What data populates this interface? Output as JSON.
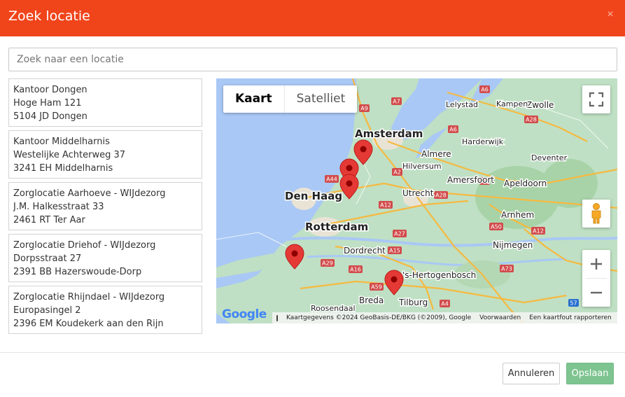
{
  "dialog": {
    "title": "Zoek locatie",
    "close_glyph": "×"
  },
  "search": {
    "placeholder": "Zoek naar een locatie",
    "value": ""
  },
  "locations": [
    {
      "name": "Kantoor Dongen",
      "street": "Hoge Ham  121",
      "city": "5104 JD   Dongen"
    },
    {
      "name": "Kantoor Middelharnis",
      "street": "Westelijke Achterweg  37",
      "city": "3241 EH   Middelharnis"
    },
    {
      "name": "Zorglocatie Aarhoeve - WIJdezorg",
      "street": "J.M. Halkesstraat  33",
      "city": "2461 RT   Ter Aar"
    },
    {
      "name": "Zorglocatie Driehof - WIJdezorg",
      "street": "Dorpsstraat  27",
      "city": "2391 BB   Hazerswoude-Dorp"
    },
    {
      "name": "Zorglocatie Rhijndael - WIJdezorg",
      "street": "Europasingel  2",
      "city": "2396 EM   Koudekerk aan den Rijn"
    }
  ],
  "map": {
    "type_map": "Kaart",
    "type_satellite": "Satelliet",
    "active_type": "Kaart",
    "logo": "Google",
    "attribution": "Kaartgegevens ©2024 GeoBasis-DE/BKG (©2009), Google",
    "terms": "Voorwaarden",
    "report": "Een kaartfout rapporteren",
    "icons": {
      "fullscreen": "fullscreen-icon",
      "pegman": "pegman-icon",
      "zoom_in": "zoom-in-icon",
      "zoom_out": "zoom-out-icon",
      "marker": "map-marker-icon",
      "keyboard": "keyboard-icon"
    },
    "cities": {
      "amsterdam": "Amsterdam",
      "den_haag": "Den Haag",
      "rotterdam": "Rotterdam",
      "utrecht": "Utrecht",
      "almere": "Almere",
      "hilversum": "Hilversum",
      "amersfoort": "Amersfoort",
      "apeldoorn": "Apeldoorn",
      "arnhem": "Arnhem",
      "nijmegen": "Nijmegen",
      "dordrecht": "Dordrecht",
      "s_hertogenbosch": "'s-Hertogenbosch",
      "breda": "Breda",
      "tilburg": "Tilburg",
      "roosendaal": "Roosendaal",
      "zwolle": "Zwolle",
      "lelystad": "Lelystad",
      "kampen": "Kampen",
      "harderwijk": "Harderwijk",
      "deventer": "Deventer"
    },
    "roads": {
      "a6": "A6",
      "a7": "A7",
      "a9": "A9",
      "a1": "A1",
      "a2": "A2",
      "a4": "A4",
      "a44": "A44",
      "a12": "A12",
      "a28": "A28",
      "a27": "A27",
      "a15": "A15",
      "a16": "A16",
      "a29": "A29",
      "a59": "A59",
      "a50": "A50",
      "a73": "A73",
      "a57": "57"
    }
  },
  "footer": {
    "cancel": "Annuleren",
    "save": "Opslaan"
  },
  "colors": {
    "header": "#f0441b",
    "save_button": "#7ec490",
    "water": "#a9c8f5",
    "land": "#bfe0c4",
    "marker": "#e53935"
  }
}
